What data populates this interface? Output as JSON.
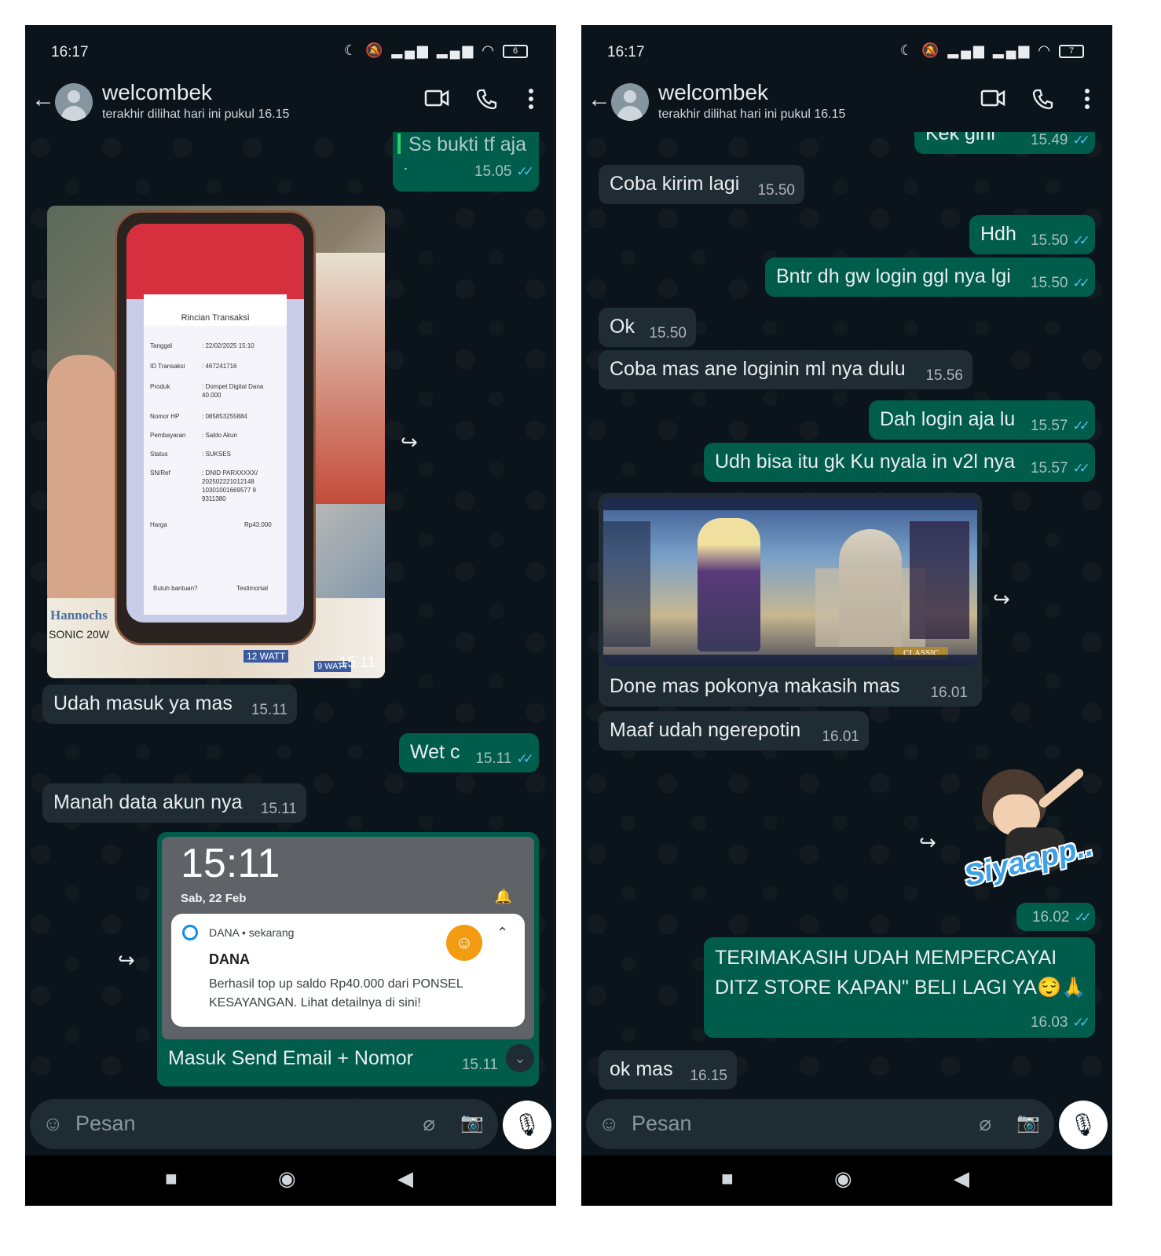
{
  "left": {
    "status": {
      "time": "16:17",
      "battery": "6"
    },
    "header": {
      "name": "welcombek",
      "last_seen": "terakhir dilihat hari ini pukul 16.15"
    },
    "messages": {
      "m0": {
        "text": "Ss bukti tf aja",
        "sub": ".",
        "time": "15.05"
      },
      "receipt": {
        "title": "Rincian Transaksi",
        "rows": [
          {
            "label": "Tanggal",
            "value": ": 22/02/2025 15:10"
          },
          {
            "label": "ID Transaksi",
            "value": ": 467241716"
          },
          {
            "label": "Produk",
            "value": ": Dompet Digital Dana 40.000"
          },
          {
            "label": "Nomor HP",
            "value": ": 085853255884"
          },
          {
            "label": "Pembayaran",
            "value": ": Saldo Akun"
          },
          {
            "label": "Status",
            "value": ": SUKSES"
          },
          {
            "label": "SN/Ref",
            "value": ": DNID PARXXXXX/ 202502221012148 10301001669577 9 9311380"
          },
          {
            "label": "Harga",
            "value": "Rp43.000"
          }
        ],
        "help": "Butuh bantuan?",
        "testimonial": "Testimonial",
        "box_labels": [
          "Hannochs",
          "SONIC 20W",
          "12 WATT",
          "9 WATT"
        ],
        "time": "15.11"
      },
      "m1": {
        "text": "Udah masuk ya mas",
        "time": "15.11"
      },
      "m2": {
        "text": "Wet c",
        "time": "15.11"
      },
      "m3": {
        "text": "Manah data akun nya",
        "time": "15.11"
      },
      "m4": {
        "lock_time": "15:11",
        "lock_date": "Sab, 22 Feb",
        "app": "DANA • sekarang",
        "title": "DANA",
        "body": "Berhasil top up saldo Rp40.000 dari PONSEL KESAYANGAN. Lihat detailnya di sini!",
        "caption": "Masuk Send Email + Nomor",
        "time": "15.11"
      }
    },
    "composer": {
      "placeholder": "Pesan"
    }
  },
  "right": {
    "status": {
      "time": "16:17",
      "battery": "7"
    },
    "header": {
      "name": "welcombek",
      "last_seen": "terakhir dilihat hari ini pukul 16.15"
    },
    "messages": {
      "r0": {
        "text": "Kek gini",
        "time": "15.49"
      },
      "r1": {
        "text": "Coba kirim lagi",
        "time": "15.50"
      },
      "r2": {
        "text": "Hdh",
        "time": "15.50"
      },
      "r3": {
        "text": "Bntr dh gw login ggl nya lgi",
        "time": "15.50"
      },
      "r4": {
        "text": "Ok",
        "time": "15.50"
      },
      "r5": {
        "text": "Coba mas ane loginin ml nya dulu",
        "time": "15.56"
      },
      "r6": {
        "text": "Dah login aja lu",
        "time": "15.57"
      },
      "r7": {
        "text": "Udh bisa itu gk Ku nyala in v2l nya",
        "time": "15.57"
      },
      "r8": {
        "text": "Done mas pokonya makasih mas",
        "time": "16.01",
        "game_badge": "CLASSIC"
      },
      "r9": {
        "text": "Maaf udah ngerepotin",
        "time": "16.01"
      },
      "sticker": {
        "text": "Siyaapp..",
        "time": "16.02"
      },
      "r10": {
        "line1": "TERIMAKASIH UDAH MEMPERCAYAI",
        "line2": "DITZ STORE KAPAN\" BELI LAGI YA",
        "emoji": "😌🙏",
        "time": "16.03"
      },
      "r11": {
        "text": "ok mas",
        "time": "16.15"
      }
    },
    "composer": {
      "placeholder": "Pesan"
    }
  },
  "icons": {
    "back": "arrow-left-icon",
    "video": "video-call-icon",
    "call": "phone-call-icon",
    "menu": "more-vert-icon",
    "forward": "forward-icon",
    "emoji": "emoji-icon",
    "attach": "paperclip-icon",
    "camera": "camera-icon",
    "mic": "mic-icon"
  },
  "colors": {
    "background": "#0b141a",
    "incoming_bubble": "#202c33",
    "outgoing_bubble": "#005c4b",
    "read_check": "#53bdeb",
    "receipt_header": "#d6303f",
    "dana_accent": "#f39c12"
  }
}
